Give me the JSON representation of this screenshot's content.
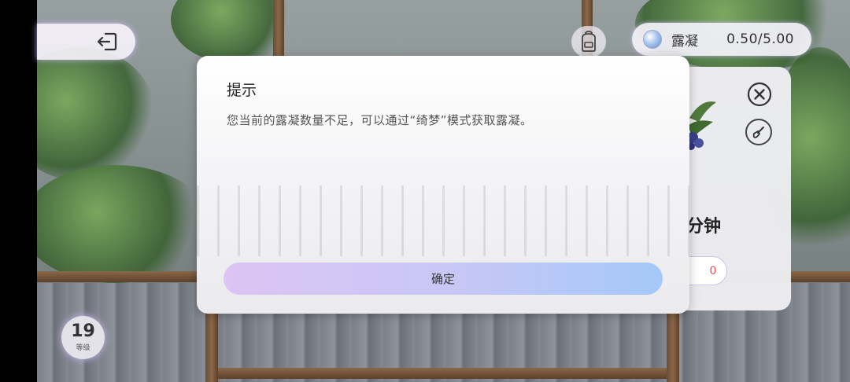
{
  "top_bar": {
    "exit_icon": "exit-icon",
    "backpack_icon": "backpack-icon",
    "currency": {
      "icon": "dew-drop-icon",
      "label": "露凝",
      "value": "0.50/5.00"
    }
  },
  "detail_panel": {
    "close_icon": "close-icon",
    "shovel_icon": "shovel-icon",
    "time_text": "分钟",
    "button_text": "0"
  },
  "level": {
    "number": "19",
    "label": "等级"
  },
  "dialog": {
    "title": "提示",
    "message": "您当前的露凝数量不足，可以通过“绮梦”模式获取露凝。",
    "confirm_label": "确定"
  },
  "colors": {
    "confirm_gradient_start": "#dcc4f4",
    "confirm_gradient_end": "#a4c8f8",
    "frame_wood": "#8a6748"
  }
}
